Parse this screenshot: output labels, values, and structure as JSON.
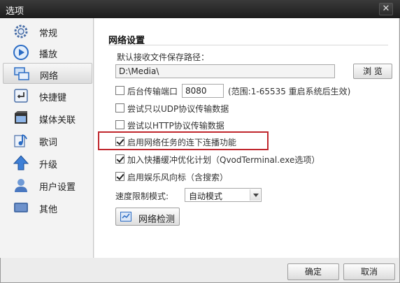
{
  "window": {
    "title": "选项",
    "close_glyph": "✕"
  },
  "sidebar": {
    "items": [
      {
        "label": "常规",
        "icon": "gear-icon"
      },
      {
        "label": "播放",
        "icon": "play-icon"
      },
      {
        "label": "网络",
        "icon": "network-icon"
      },
      {
        "label": "快捷键",
        "icon": "enter-key-icon"
      },
      {
        "label": "媒体关联",
        "icon": "film-icon"
      },
      {
        "label": "歌词",
        "icon": "music-note-icon"
      },
      {
        "label": "升级",
        "icon": "up-arrow-icon"
      },
      {
        "label": "用户设置",
        "icon": "user-icon"
      },
      {
        "label": "其他",
        "icon": "other-icon"
      }
    ],
    "active_index": 2
  },
  "network": {
    "section_title": "网络设置",
    "default_path_label": "默认接收文件保存路径：",
    "default_path_value": "D:\\Media\\",
    "browse_label": "浏 览",
    "background_port_label": "后台传输端口",
    "background_port_checked": false,
    "port_value": "8080",
    "port_range_note": "(范围:1-65535 重启系统后生效)",
    "udp_label": "尝试只以UDP协议传输数据",
    "udp_checked": false,
    "http_label": "尝试以HTTP协议传输数据",
    "http_checked": false,
    "continue_play_label": "启用网络任务的连下连播功能",
    "continue_play_checked": true,
    "qvod_plan_label": "加入快播缓冲优化计划（QvodTerminal.exe选项）",
    "qvod_plan_checked": true,
    "entertain_label": "启用娱乐风向标（含搜索）",
    "entertain_checked": true,
    "speed_mode_label": "速度限制模式:",
    "speed_mode_value": "自动模式",
    "net_check_label": "网络检测"
  },
  "footer": {
    "ok_label": "确定",
    "cancel_label": "取消"
  },
  "colors": {
    "highlight": "#c0272d",
    "accent_blue": "#2b6cc4"
  }
}
